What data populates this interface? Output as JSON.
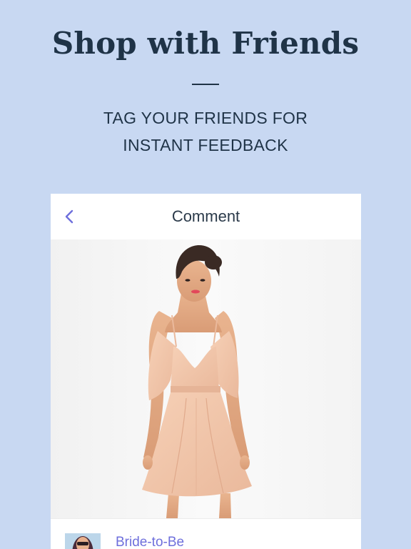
{
  "hero": {
    "title": "Shop with Friends",
    "subtitle_line1": "TAG YOUR FRIENDS FOR",
    "subtitle_line2": "INSTANT FEEDBACK"
  },
  "screen": {
    "title": "Comment",
    "back_icon": "chevron-left-icon",
    "image_alt": "Woman wearing a peach cold-shoulder chiffon dress",
    "comment": {
      "username": "Bride-to-Be",
      "avatar_icon": "user-avatar"
    }
  },
  "colors": {
    "background": "#c8d8f2",
    "headline": "#1f3347",
    "accent": "#6e6fdc",
    "dress": "#f4c9ad"
  }
}
